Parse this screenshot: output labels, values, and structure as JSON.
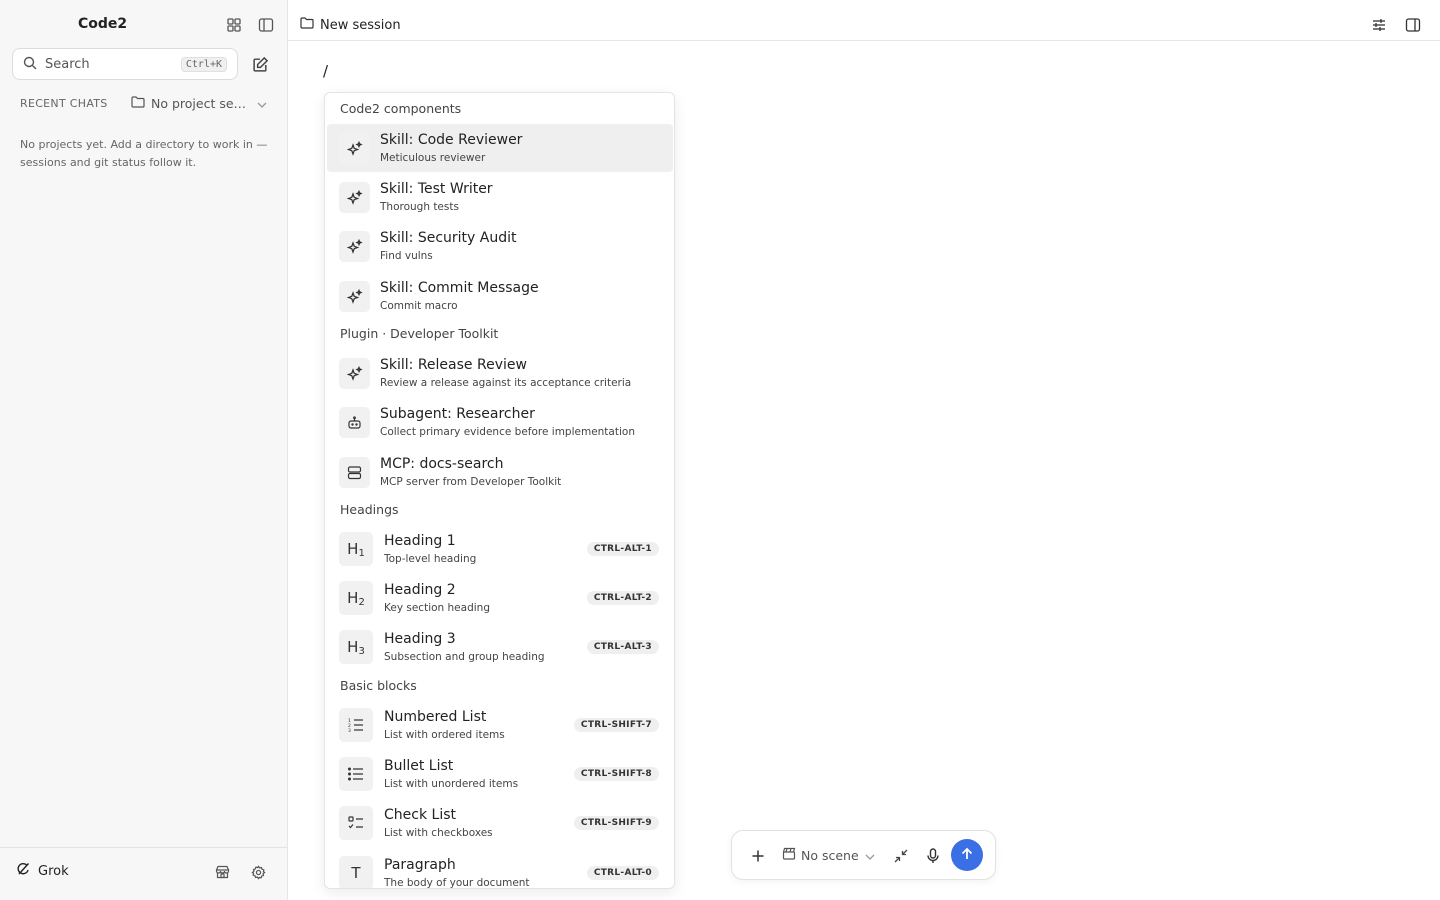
{
  "sidebar": {
    "app_title": "Code2",
    "search_label": "Search",
    "search_shortcut": "Ctrl+K",
    "recent_label": "RECENT CHATS",
    "project_selector": "No project selected",
    "empty_message": "No projects yet. Add a directory to work in — sessions and git status follow it.",
    "footer_model": "Grok"
  },
  "topbar": {
    "session_title": "New session"
  },
  "editor": {
    "slash": "/"
  },
  "popup": {
    "sections": [
      {
        "title": "Code2 components",
        "items": [
          {
            "title": "Skill: Code Reviewer",
            "desc": "Meticulous reviewer",
            "icon": "sparkles-icon",
            "active": true
          },
          {
            "title": "Skill: Test Writer",
            "desc": "Thorough tests",
            "icon": "sparkles-icon"
          },
          {
            "title": "Skill: Security Audit",
            "desc": "Find vulns",
            "icon": "sparkles-icon"
          },
          {
            "title": "Skill: Commit Message",
            "desc": "Commit macro",
            "icon": "sparkles-icon"
          }
        ]
      },
      {
        "title": "Plugin · Developer Toolkit",
        "items": [
          {
            "title": "Skill: Release Review",
            "desc": "Review a release against its acceptance criteria",
            "icon": "sparkles-icon"
          },
          {
            "title": "Subagent: Researcher",
            "desc": "Collect primary evidence before implementation",
            "icon": "robot-icon"
          },
          {
            "title": "MCP: docs-search",
            "desc": "MCP server from Developer Toolkit",
            "icon": "server-icon"
          }
        ]
      },
      {
        "title": "Headings",
        "items": [
          {
            "title": "Heading 1",
            "desc": "Top-level heading",
            "icon": "heading-1-icon",
            "glyph": "H",
            "sub": "1",
            "shortcut": "CTRL-ALT-1"
          },
          {
            "title": "Heading 2",
            "desc": "Key section heading",
            "icon": "heading-2-icon",
            "glyph": "H",
            "sub": "2",
            "shortcut": "CTRL-ALT-2"
          },
          {
            "title": "Heading 3",
            "desc": "Subsection and group heading",
            "icon": "heading-3-icon",
            "glyph": "H",
            "sub": "3",
            "shortcut": "CTRL-ALT-3"
          }
        ]
      },
      {
        "title": "Basic blocks",
        "items": [
          {
            "title": "Numbered List",
            "desc": "List with ordered items",
            "icon": "numbered-list-icon",
            "shortcut": "CTRL-SHIFT-7"
          },
          {
            "title": "Bullet List",
            "desc": "List with unordered items",
            "icon": "bullet-list-icon",
            "shortcut": "CTRL-SHIFT-8"
          },
          {
            "title": "Check List",
            "desc": "List with checkboxes",
            "icon": "check-list-icon",
            "shortcut": "CTRL-SHIFT-9"
          },
          {
            "title": "Paragraph",
            "desc": "The body of your document",
            "icon": "paragraph-icon",
            "glyph": "T",
            "shortcut": "CTRL-ALT-0"
          }
        ]
      }
    ]
  },
  "composer": {
    "scene_label": "No scene"
  },
  "colors": {
    "accent": "#3b6fe6",
    "sidebar_bg": "#f7f7f7"
  }
}
